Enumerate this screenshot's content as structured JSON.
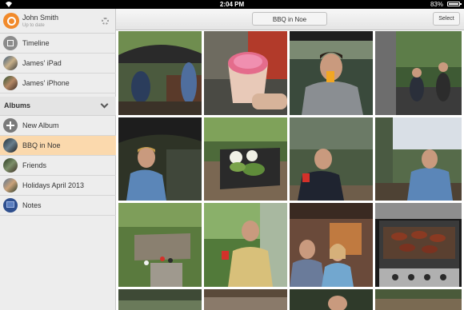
{
  "status_bar": {
    "time": "2:04 PM",
    "battery": "83%",
    "battery_fraction": 0.83
  },
  "sidebar": {
    "user": {
      "name": "John Smith",
      "status": "Up to date"
    },
    "sources": [
      {
        "label": "Timeline",
        "icon": "timeline-icon"
      },
      {
        "label": "James' iPad",
        "icon": "ipad-thumbnail"
      },
      {
        "label": "James' iPhone",
        "icon": "iphone-thumbnail"
      }
    ],
    "albums_header": "Albums",
    "albums": [
      {
        "label": "New Album",
        "icon": "plus-icon"
      },
      {
        "label": "BBQ in Noe",
        "icon": "album-thumbnail",
        "selected": true
      },
      {
        "label": "Friends",
        "icon": "album-thumbnail"
      },
      {
        "label": "Holidays April 2013",
        "icon": "album-thumbnail"
      },
      {
        "label": "Notes",
        "icon": "notes-icon"
      }
    ]
  },
  "main": {
    "title": "BBQ in Noe",
    "select_label": "Select",
    "photos": [
      {
        "desc": "people at patio table"
      },
      {
        "desc": "pink drink close-up"
      },
      {
        "desc": "man drinking orange juice"
      },
      {
        "desc": "people sitting outside"
      },
      {
        "desc": "man with umbrella"
      },
      {
        "desc": "table with food"
      },
      {
        "desc": "man with red cup"
      },
      {
        "desc": "man on deck"
      },
      {
        "desc": "garden terrace"
      },
      {
        "desc": "man holding cup"
      },
      {
        "desc": "people in kitchen"
      },
      {
        "desc": "grill with meat"
      }
    ]
  },
  "colors": {
    "accent": "#f18a2b",
    "selected_row": "#fbd9ad",
    "sidebar_bg": "#ededed"
  }
}
